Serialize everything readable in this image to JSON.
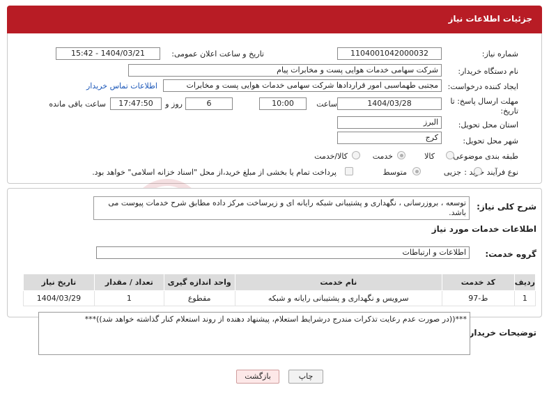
{
  "header": {
    "title": "جزئیات اطلاعات نیاز"
  },
  "need_info": {
    "need_number_label": "شماره نیاز:",
    "need_number": "1104001042000032",
    "announce_label": "تاریخ و ساعت اعلان عمومی:",
    "announce_value": "1404/03/21 - 15:42",
    "buyer_org_label": "نام دستگاه خریدار:",
    "buyer_org": "شرکت سهامی خدمات هوایی پست و مخابرات پیام",
    "requester_label": "ایجاد کننده درخواست:",
    "requester": "مجتبی طهماسبی امور قراردادها شرکت سهامی خدمات هوایی پست و مخابرات",
    "contact_link": "اطلاعات تماس خریدار",
    "deadline_label": "مهلت ارسال پاسخ: تا تاریخ:",
    "deadline_date": "1404/03/28",
    "time_label": "ساعت",
    "deadline_time": "10:00",
    "days_value": "6",
    "days_label": "روز و",
    "remaining_time": "17:47:50",
    "remaining_label": "ساعت باقی مانده",
    "province_label": "استان محل تحویل:",
    "province": "البرز",
    "city_label": "شهر محل تحویل:",
    "city": "کرج",
    "category_label": "طبقه بندی موضوعی:",
    "category_options": [
      "کالا",
      "خدمت",
      "کالا/خدمت"
    ],
    "category_selected": "خدمت",
    "process_label": "نوع فرآیند خرید :",
    "process_options": [
      "جزیی",
      "متوسط"
    ],
    "process_selected": "متوسط",
    "treasury_note": "پرداخت تمام یا بخشی از مبلغ خرید،از محل \"اسناد خزانه اسلامی\" خواهد بود."
  },
  "description": {
    "label": "شرح کلی نیاز:",
    "text": "توسعه ، بروزرسانی ، نگهداری و پشتیبانی شبکه رایانه ای و زیرساخت مرکز داده  مطابق شرح خدمات پیوست می باشد."
  },
  "services": {
    "section_title": "اطلاعات خدمات مورد نیاز",
    "group_label": "گروه خدمت:",
    "group_value": "اطلاعات و ارتباطات",
    "columns": [
      "ردیف",
      "کد خدمت",
      "نام خدمت",
      "واحد اندازه گیری",
      "تعداد / مقدار",
      "تاریخ نیاز"
    ],
    "rows": [
      [
        "1",
        "ط-97",
        "سرویس و نگهداری و پشتیبانی رایانه و شبکه",
        "مقطوع",
        "1",
        "1404/03/29"
      ]
    ]
  },
  "buyer_notes": {
    "label": "توضیحات خریدار:",
    "text": "***((در صورت عدم رعایت تذکرات مندرج درشرایط استعلام، پیشنهاد دهنده از روند استعلام کنار گذاشته خواهد شد))***"
  },
  "actions": {
    "print": "چاپ",
    "back": "بازگشت"
  },
  "watermark": {
    "text": "AriaTender.neT"
  }
}
